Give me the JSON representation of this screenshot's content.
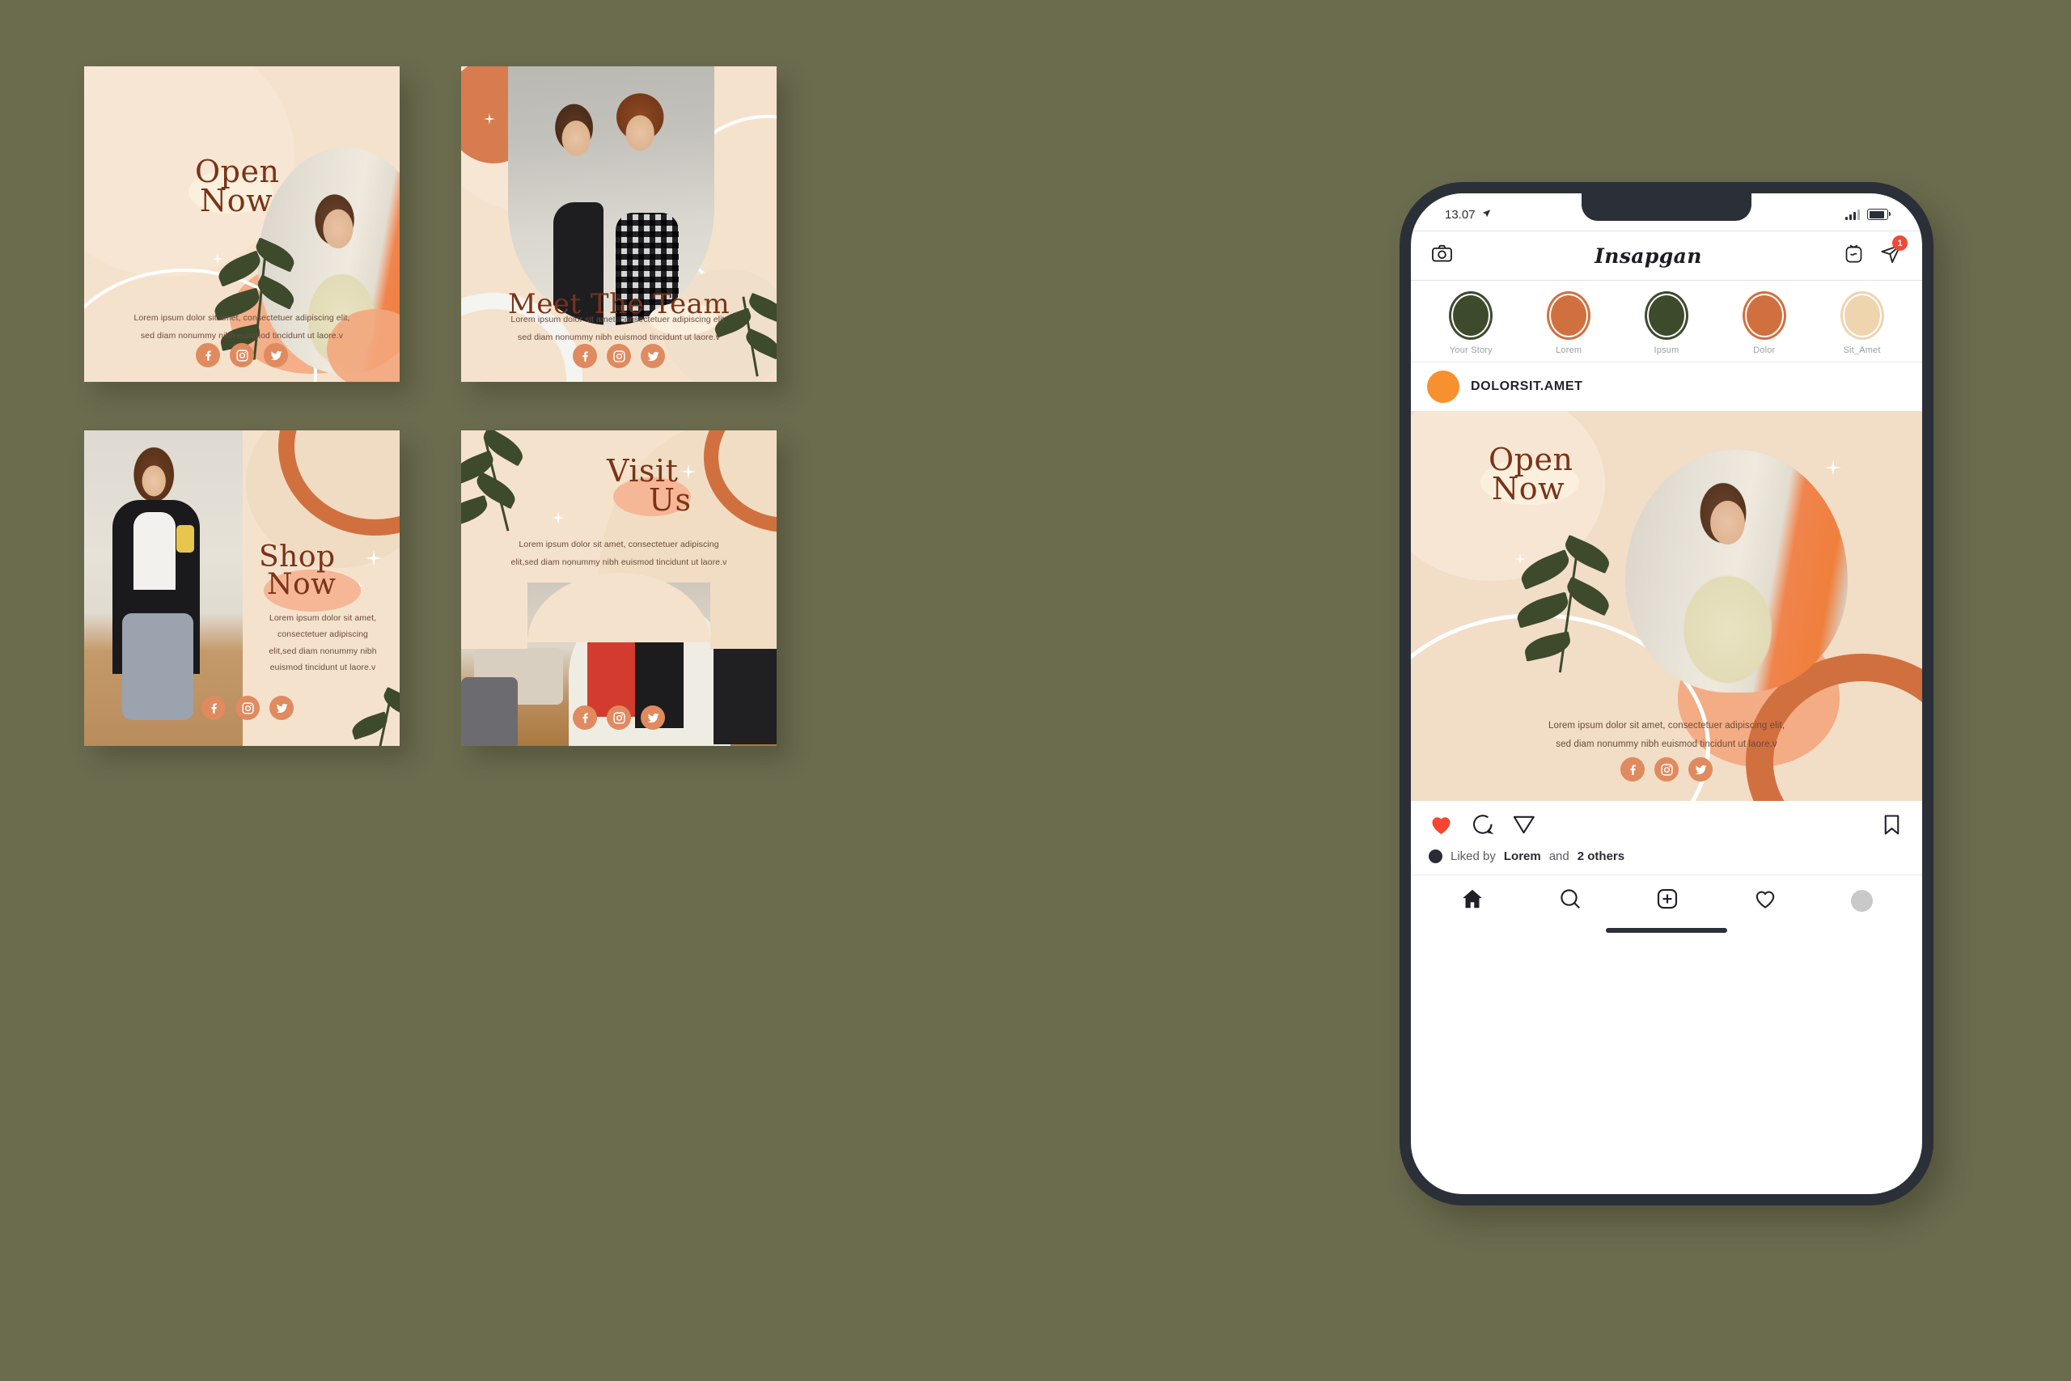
{
  "theme": {
    "background": "#6b6b4e",
    "card_bg": "#f5e2cd",
    "accent_orange": "#d1703f",
    "accent_peach": "#f3a67c",
    "accent_green": "#3d4a2c",
    "title_brown": "#7a3318",
    "body_brown": "#6b4a3b",
    "cream": "#fbf0dd"
  },
  "social_icons": [
    "facebook-icon",
    "instagram-icon",
    "twitter-icon"
  ],
  "cards": {
    "open_now": {
      "title_line1": "Open",
      "title_line2": "Now",
      "body_line1": "Lorem ipsum dolor sit amet, consectetuer adipiscing elit,",
      "body_line2": "sed diam nonummy nibh euismod tincidunt ut laore.v"
    },
    "meet_team": {
      "title": "Meet The Team",
      "body_line1": "Lorem ipsum dolor sit amet, consectetuer adipiscing elit,",
      "body_line2": "sed diam nonummy nibh euismod tincidunt ut laore.v"
    },
    "shop_now": {
      "title_line1": "Shop",
      "title_line2": "Now",
      "body_line1": "Lorem ipsum dolor sit amet,",
      "body_line2": "consectetuer adipiscing",
      "body_line3": "elit,sed diam nonummy nibh",
      "body_line4": "euismod tincidunt ut laore.v"
    },
    "visit_us": {
      "title_line1": "Visit",
      "title_line2": "Us",
      "body_line1": "Lorem ipsum dolor sit amet, consectetuer adipiscing",
      "body_line2": "elit,sed diam nonummy nibh euismod tincidunt ut laore.v"
    }
  },
  "phone": {
    "status": {
      "time": "13.07",
      "location_icon": "location-arrow-icon",
      "signal_icon": "signal-bars-icon",
      "battery_icon": "battery-icon"
    },
    "header": {
      "camera_icon": "camera-icon",
      "logo": "Insapgan",
      "igtv_icon": "igtv-icon",
      "send_icon": "send-message-icon",
      "badge_count": "1"
    },
    "stories": [
      {
        "label": "Your Story",
        "color": "#3d4a2c"
      },
      {
        "label": "Lorem",
        "color": "#d1703f"
      },
      {
        "label": "Ipsum",
        "color": "#3d4a2c"
      },
      {
        "label": "Dolor",
        "color": "#d1703f"
      },
      {
        "label": "Sit_Amet",
        "color": "#efd4b0"
      }
    ],
    "post": {
      "username": "DOLORSIT.AMET",
      "title_line1": "Open",
      "title_line2": "Now",
      "body_line1": "Lorem ipsum dolor sit amet, consectetuer adipiscing elit,",
      "body_line2": "sed diam nonummy nibh euismod tincidunt ut laore.v"
    },
    "actions": {
      "like_icon": "heart-filled-icon",
      "comment_icon": "comment-icon",
      "share_icon": "send-message-icon",
      "save_icon": "bookmark-icon",
      "like_color": "#f7452f"
    },
    "likes": {
      "prefix": "Liked by",
      "user": "Lorem",
      "middle": "and",
      "others": "2 others"
    },
    "tabbar": [
      "home-icon",
      "search-icon",
      "add-post-icon",
      "heart-icon",
      "profile-avatar-icon"
    ]
  }
}
